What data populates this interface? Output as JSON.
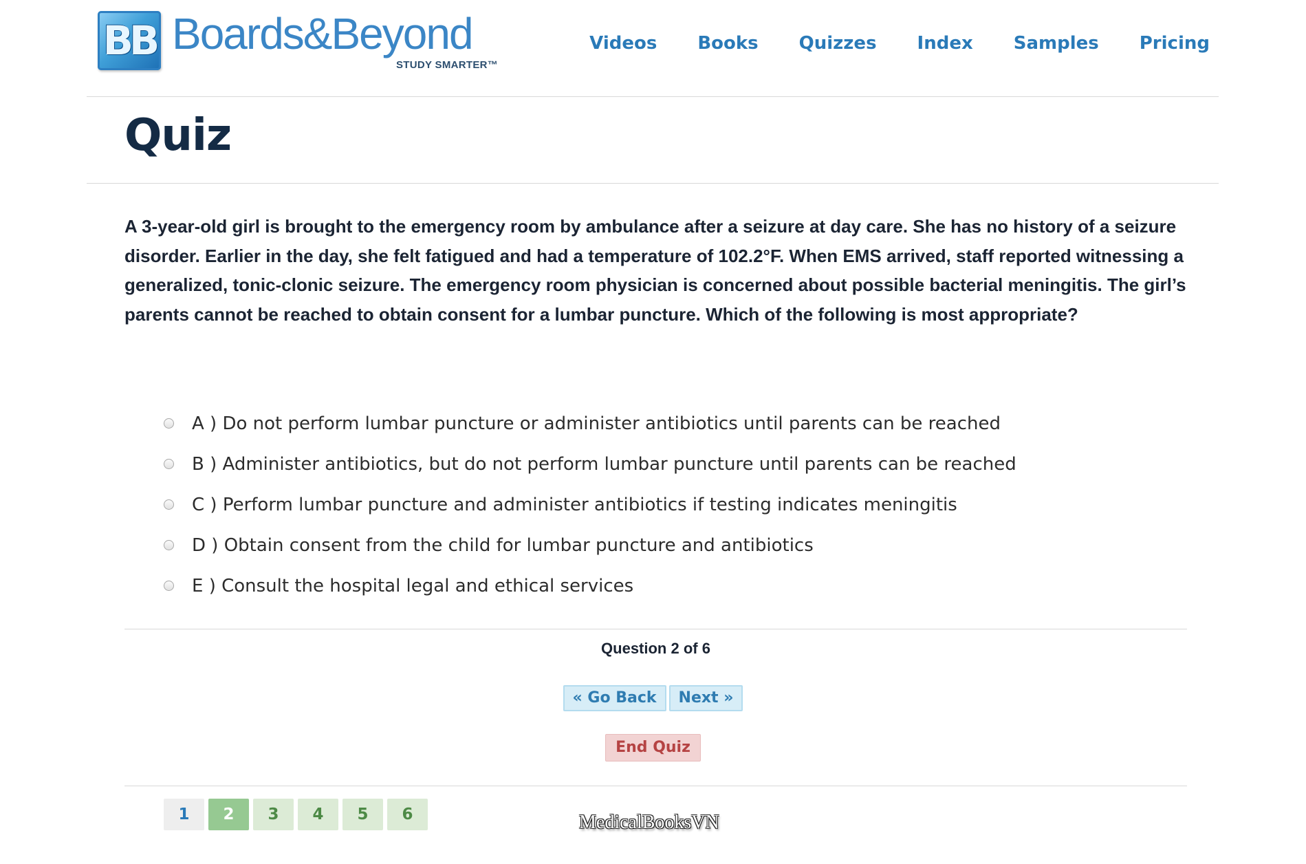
{
  "brand": {
    "logo_mark": "BB",
    "name": "Boards&Beyond",
    "tagline": "STUDY SMARTER™"
  },
  "nav": {
    "items": [
      "Videos",
      "Books",
      "Quizzes",
      "Index",
      "Samples",
      "Pricing"
    ]
  },
  "page_title": "Quiz",
  "question": {
    "text": "A 3-year-old girl is brought to the emergency room by ambulance after a seizure at day care. She has no history of a seizure disorder. Earlier in the day, she felt fatigued and had a temperature of 102.2°F. When EMS arrived, staff reported witnessing a generalized, tonic-clonic seizure. The emergency room physician is concerned about possible bacterial meningitis. The girl’s parents cannot be reached to obtain consent for a lumbar puncture. Which of the following is most appropriate?"
  },
  "options": [
    {
      "label": "A ) Do not perform lumbar puncture or administer antibiotics until parents can be reached"
    },
    {
      "label": "B ) Administer antibiotics, but do not perform lumbar puncture until parents can be reached"
    },
    {
      "label": "C ) Perform lumbar puncture and administer antibiotics if testing indicates meningitis"
    },
    {
      "label": "D ) Obtain consent from the child for lumbar puncture and antibiotics"
    },
    {
      "label": "E ) Consult the hospital legal and ethical services"
    }
  ],
  "progress_text": "Question 2 of 6",
  "buttons": {
    "go_back": "« Go Back",
    "next": "Next »",
    "end_quiz": "End Quiz"
  },
  "pager": [
    "1",
    "2",
    "3",
    "4",
    "5",
    "6"
  ],
  "watermark": "MedicalBooksVN",
  "colors": {
    "nav_link": "#2a7ab8",
    "title": "#142b45",
    "nav_button_bg": "#d7edf7",
    "end_button_bg": "#f2d3d3",
    "end_button_text": "#b54343",
    "pager_active": "#96c992",
    "pager_todo": "#dcebd6"
  }
}
